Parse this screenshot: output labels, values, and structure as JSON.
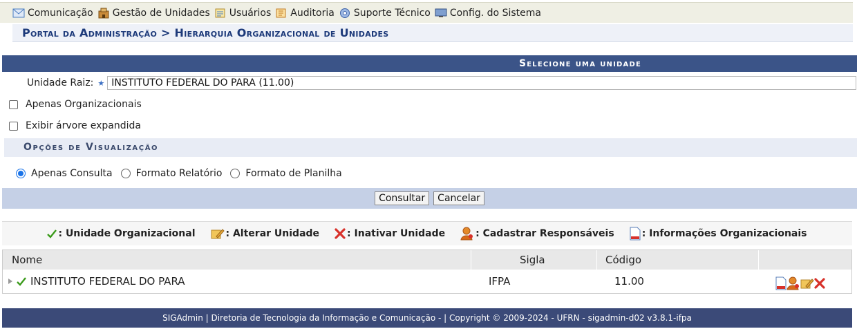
{
  "menu": {
    "items": [
      {
        "label": "Comunicação",
        "icon": "envelope-icon"
      },
      {
        "label": "Gestão de Unidades",
        "icon": "building-icon"
      },
      {
        "label": "Usuários",
        "icon": "users-icon"
      },
      {
        "label": "Auditoria",
        "icon": "audit-icon"
      },
      {
        "label": "Suporte Técnico",
        "icon": "support-icon"
      },
      {
        "label": "Config. do Sistema",
        "icon": "monitor-icon"
      }
    ]
  },
  "breadcrumb": "Portal da Administração > Hierarquia Organizacional de Unidades",
  "form": {
    "caption": "Selecione uma unidade",
    "raiz_label": "Unidade Raiz:",
    "raiz_value": "INSTITUTO FEDERAL DO PARA (11.00)",
    "only_org_label": "Apenas Organizacionais",
    "expand_tree_label": "Exibir árvore expandida",
    "view_options_heading": "Opções de Visualização",
    "view_options": [
      {
        "label": "Apenas Consulta",
        "checked": true
      },
      {
        "label": "Formato Relatório",
        "checked": false
      },
      {
        "label": "Formato de Planilha",
        "checked": false
      }
    ],
    "consult_button": "Consultar",
    "cancel_button": "Cancelar"
  },
  "legend": [
    {
      "icon": "check-icon",
      "label": ": Unidade Organizacional"
    },
    {
      "icon": "edit-icon",
      "label": ": Alterar Unidade"
    },
    {
      "icon": "cross-icon",
      "label": ": Inativar Unidade"
    },
    {
      "icon": "person-icon",
      "label": ": Cadastrar Responsáveis"
    },
    {
      "icon": "document-icon",
      "label": ": Informações Organizacionais"
    }
  ],
  "table": {
    "headers": [
      "Nome",
      "Sigla",
      "Código",
      ""
    ],
    "rows": [
      {
        "nome": "INSTITUTO FEDERAL DO PARA",
        "sigla": "IFPA",
        "codigo": "11.00"
      }
    ]
  },
  "footer": "SIGAdmin | Diretoria de Tecnologia da Informação e Comunicação - | Copyright © 2009-2024 - UFRN - sigadmin-d02 v3.8.1-ifpa",
  "colors": {
    "header_blue": "#3b5488",
    "breadcrumb_blue": "#1d3a7a",
    "footer_blue": "#3b4a78"
  }
}
